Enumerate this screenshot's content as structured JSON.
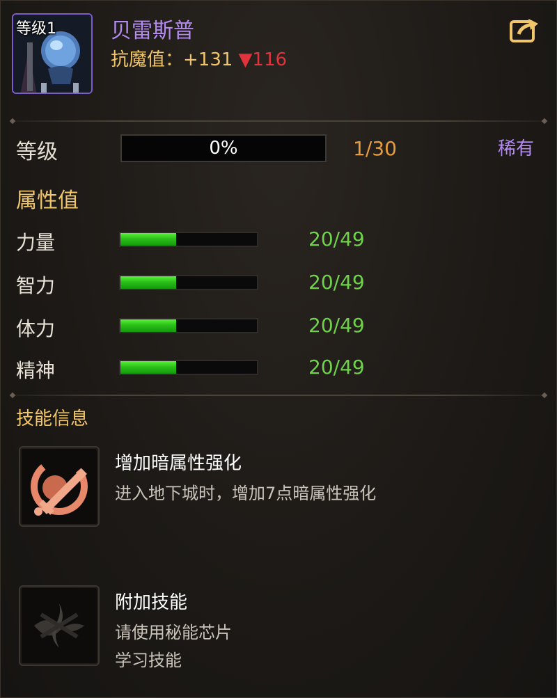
{
  "header": {
    "avatar_level": "等级1",
    "title": "贝雷斯普",
    "resist_label": "抗魔值：",
    "resist_value": "+131",
    "resist_diff": "▼116",
    "share_icon": "share-external-icon"
  },
  "level": {
    "label": "等级",
    "progress_percent": 0,
    "progress_text": "0%",
    "count": "1/30",
    "rarity": "稀有"
  },
  "attributes": {
    "title": "属性值",
    "items": [
      {
        "label": "力量",
        "value": "20/49",
        "fill": 0.41
      },
      {
        "label": "智力",
        "value": "20/49",
        "fill": 0.41
      },
      {
        "label": "体力",
        "value": "20/49",
        "fill": 0.41
      },
      {
        "label": "精神",
        "value": "20/49",
        "fill": 0.41
      }
    ]
  },
  "skills": {
    "title": "技能信息",
    "items": [
      {
        "name": "增加暗属性强化",
        "desc1": "进入地下城时，增加7点暗属性强化",
        "desc2": "",
        "icon": "dark-sword-icon"
      },
      {
        "name": "附加技能",
        "desc1": "请使用秘能芯片",
        "desc2": "学习技能",
        "icon": "locked-skill-icon"
      }
    ]
  },
  "colors": {
    "title_purple": "#b48cf0",
    "gold": "#f1c56a",
    "green_value": "#6fd24a",
    "orange_count": "#e89c3c",
    "red_diff": "#e0333b"
  }
}
